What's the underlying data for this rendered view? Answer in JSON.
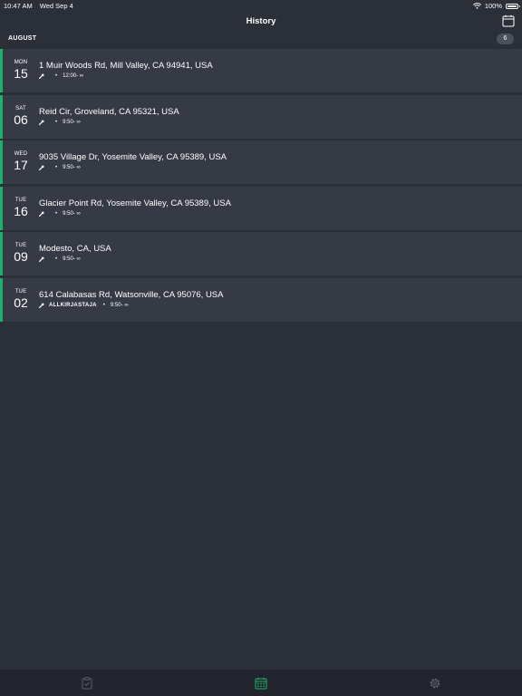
{
  "status_bar": {
    "time": "10:47 AM",
    "date": "Wed Sep 4",
    "battery": "100%"
  },
  "nav": {
    "title": "History"
  },
  "section": {
    "title": "AUGUST",
    "count": "6"
  },
  "history": [
    {
      "day_name": "MON",
      "day_number": "15",
      "address": "1 Muir Woods Rd, Mill Valley, CA 94941, USA",
      "label": "",
      "time": "12:00- ∞"
    },
    {
      "day_name": "SAT",
      "day_number": "06",
      "address": "Reid Cir, Groveland, CA 95321, USA",
      "label": "",
      "time": "9:50- ∞"
    },
    {
      "day_name": "WED",
      "day_number": "17",
      "address": "9035 Village Dr, Yosemite Valley, CA 95389, USA",
      "label": "",
      "time": "9:50- ∞"
    },
    {
      "day_name": "TUE",
      "day_number": "16",
      "address": "Glacier Point Rd, Yosemite Valley, CA 95389, USA",
      "label": "",
      "time": "9:50- ∞"
    },
    {
      "day_name": "TUE",
      "day_number": "09",
      "address": "Modesto, CA, USA",
      "label": "",
      "time": "9:50- ∞"
    },
    {
      "day_name": "TUE",
      "day_number": "02",
      "address": "614 Calabasas Rd, Watsonville, CA 95076, USA",
      "label": "ALLKIRJASTAJA",
      "time": "9:50- ∞"
    }
  ],
  "icons": {
    "wifi": "wifi-icon",
    "battery": "battery-icon",
    "calendar": "calendar-icon",
    "tool": "wrench-icon",
    "tab_clipboard": "clipboard-icon",
    "tab_calendar": "calendar-icon",
    "tab_settings": "gear-icon"
  },
  "colors": {
    "background": "#2b2f38",
    "row": "#353a45",
    "accent": "#19b36a",
    "tab_bar": "#22252d",
    "inactive_icon": "#5b606a"
  }
}
